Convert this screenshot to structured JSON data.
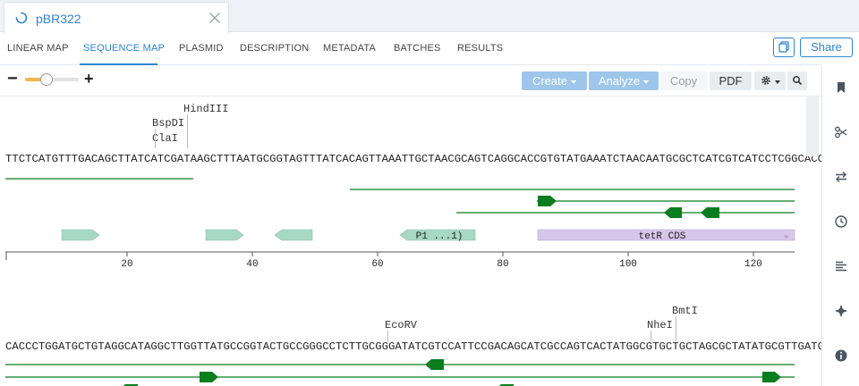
{
  "app": {
    "file_tab_title": "pBR322"
  },
  "nav": {
    "tabs": [
      {
        "label": "LINEAR MAP"
      },
      {
        "label": "SEQUENCE MAP"
      },
      {
        "label": "PLASMID"
      },
      {
        "label": "DESCRIPTION"
      },
      {
        "label": "METADATA"
      },
      {
        "label": "BATCHES"
      },
      {
        "label": "RESULTS"
      }
    ],
    "active_tab": "SEQUENCE MAP",
    "share_label": "Share"
  },
  "toolbar": {
    "zoom_minus": "−",
    "zoom_plus": "+",
    "zoom_level": 0.4,
    "create_label": "Create",
    "analyze_label": "Analyze",
    "copy_label": "Copy",
    "pdf_label": "PDF"
  },
  "colors": {
    "accent": "#2d84d1",
    "feature_green": "#0a7d1e",
    "promoter": "#a7d7c5",
    "cds": "#d7c6ea",
    "slider": "#f0b451"
  },
  "rows": [
    {
      "sequence": "TTCTCATGTTTGACAGCTTATCATCGATAAGCTTTAATGCGGTAGTTTATCACAGTTAAATTGCTAACGCAGTCAGGCACCGTGTATGAAATCTAACAATGCGCTCATCGTCATCCTCGGCACCGT",
      "cut_sites": [
        {
          "label": "HindIII"
        },
        {
          "label": "BspDI"
        },
        {
          "label": "ClaI"
        }
      ],
      "features": [
        {
          "label": ""
        },
        {
          "label": ""
        },
        {
          "label": ""
        },
        {
          "label": "P1 ...1)"
        },
        {
          "label": "tetR CDS"
        }
      ],
      "ruler_ticks": [
        "20",
        "40",
        "60",
        "80",
        "100",
        "120"
      ]
    },
    {
      "sequence": "CACCCTGGATGCTGTAGGCATAGGCTTGGTTATGCCGGTACTGCCGGGCCTCTTGCGGGATATCGTCCATTCCGACAGCATCGCCAGTCACTATGGCGTGCTGCTAGCGCTATATGCGTTGATGCA",
      "cut_sites": [
        {
          "label": "EcoRV"
        },
        {
          "label": "NheI"
        },
        {
          "label": "BmtI"
        }
      ]
    }
  ]
}
